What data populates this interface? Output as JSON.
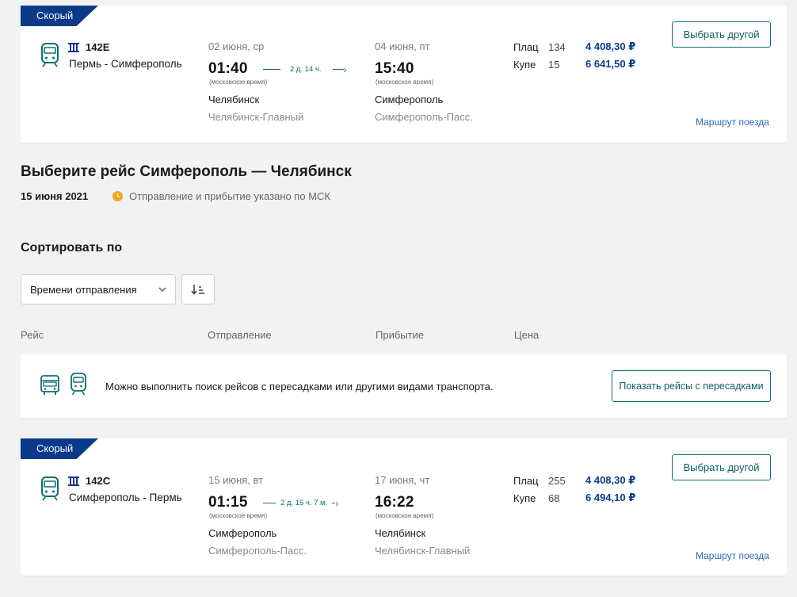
{
  "trip1": {
    "badge": "Скорый",
    "train_number": "142Е",
    "route": "Пермь - Симферополь",
    "depart_date": "02 июня, ср",
    "depart_time": "01:40",
    "depart_note": "(московское время)",
    "duration": "2 д. 14 ч.",
    "arrive_date": "04 июня, пт",
    "arrive_time": "15:40",
    "arrive_note": "(московское время)",
    "depart_city": "Челябинск",
    "depart_station": "Челябинск-Главный",
    "arrive_city": "Симферополь",
    "arrive_station": "Симферополь-Пасс.",
    "prices": [
      {
        "type": "Плац",
        "count": "134",
        "price": "4 408,30 ₽"
      },
      {
        "type": "Купе",
        "count": "15",
        "price": "6 641,50 ₽"
      }
    ],
    "choose_button": "Выбрать другой",
    "route_link": "Маршрут поезда"
  },
  "section": {
    "title": "Выберите рейс Симферополь — Челябинск",
    "date": "15 июня 2021",
    "msk_note": "Отправление и прибытие указано по МСК",
    "sort_title": "Сортировать по",
    "sort_value": "Времени отправления"
  },
  "columns": {
    "trip": "Рейс",
    "depart": "Отправление",
    "arrive": "Прибытие",
    "price": "Цена"
  },
  "transfer": {
    "text": "Можно выполнить поиск рейсов с пересадками или другими видами транспорта.",
    "button": "Показать рейсы с пересадками"
  },
  "trip2": {
    "badge": "Скорый",
    "train_number": "142С",
    "route": "Симферополь - Пермь",
    "depart_date": "15 июня, вт",
    "depart_time": "01:15",
    "depart_note": "(московское время)",
    "duration": "2 д. 15 ч. 7 м.",
    "arrive_date": "17 июня, чт",
    "arrive_time": "16:22",
    "arrive_note": "(московское время)",
    "depart_city": "Симферополь",
    "depart_station": "Симферополь-Пасс.",
    "arrive_city": "Челябинск",
    "arrive_station": "Челябинск-Главный",
    "prices": [
      {
        "type": "Плац",
        "count": "255",
        "price": "4 408,30 ₽"
      },
      {
        "type": "Купе",
        "count": "68",
        "price": "6 494,10 ₽"
      }
    ],
    "choose_button": "Выбрать другой",
    "route_link": "Маршрут поезда"
  },
  "colors": {
    "brand_blue": "#0c3a8a",
    "teal": "#0e6e73",
    "link_blue": "#2d6bb5",
    "clock_orange": "#f5a623"
  }
}
